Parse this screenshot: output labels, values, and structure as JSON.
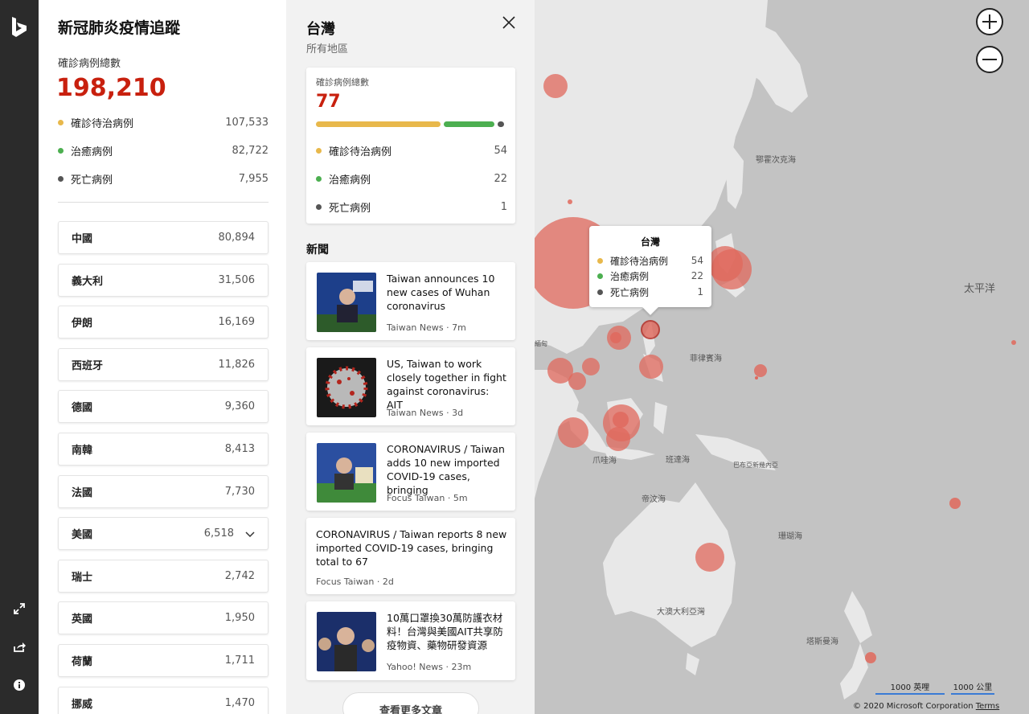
{
  "colors": {
    "active": "#e8b84b",
    "recovered": "#4caf50",
    "deaths": "#555555",
    "accent": "#c8200e",
    "bubble": "#e0685c"
  },
  "rail": {
    "logo_icon": "bing-logo-icon",
    "expand_icon": "expand-icon",
    "share_icon": "share-icon",
    "info_icon": "info-icon"
  },
  "stats": {
    "title": "新冠肺炎疫情追蹤",
    "total_label": "確診病例總數",
    "total_value": "198,210",
    "rows": [
      {
        "label": "確診待治病例",
        "value": "107,533"
      },
      {
        "label": "治癒病例",
        "value": "82,722"
      },
      {
        "label": "死亡病例",
        "value": "7,955"
      }
    ],
    "countries": [
      {
        "name": "中國",
        "value": "80,894"
      },
      {
        "name": "義大利",
        "value": "31,506"
      },
      {
        "name": "伊朗",
        "value": "16,169"
      },
      {
        "name": "西班牙",
        "value": "11,826"
      },
      {
        "name": "德國",
        "value": "9,360"
      },
      {
        "name": "南韓",
        "value": "8,413"
      },
      {
        "name": "法國",
        "value": "7,730"
      },
      {
        "name": "美國",
        "value": "6,518"
      },
      {
        "name": "瑞士",
        "value": "2,742"
      },
      {
        "name": "英國",
        "value": "1,950"
      },
      {
        "name": "荷蘭",
        "value": "1,711"
      },
      {
        "name": "挪威",
        "value": "1,470"
      }
    ]
  },
  "detail": {
    "title": "台灣",
    "subtitle": "所有地區",
    "summary": {
      "label": "確診病例總數",
      "value": "77",
      "bar": {
        "active": 54,
        "recovered": 22,
        "deaths": 1
      },
      "rows": [
        {
          "label": "確診待治病例",
          "value": "54"
        },
        {
          "label": "治癒病例",
          "value": "22"
        },
        {
          "label": "死亡病例",
          "value": "1"
        }
      ]
    },
    "news_heading": "新聞",
    "news": [
      {
        "headline": "Taiwan announces 10 new cases of Wuhan coronavirus",
        "source": "Taiwan News",
        "age": "· 7m"
      },
      {
        "headline": "US, Taiwan to work closely together in fight against coronavirus: AIT",
        "source": "Taiwan News",
        "age": "· 3d"
      },
      {
        "headline": "CORONAVIRUS / Taiwan adds 10 new imported COVID-19 cases, bringing",
        "source": "Focus Taiwan",
        "age": "· 5m"
      },
      {
        "headline": "CORONAVIRUS / Taiwan reports 8 new imported COVID-19 cases, bringing total to 67",
        "source": "Focus Taiwan",
        "age": "· 2d"
      },
      {
        "headline": "10萬口罩換30萬防護衣材料！台灣與美國AIT共享防疫物資、藥物研發資源",
        "source": "Yahoo! News",
        "age": "· 23m"
      }
    ],
    "more_label": "查看更多文章"
  },
  "map": {
    "labels": {
      "okhotsk": "鄂霍次克海",
      "pacific": "太平洋",
      "philippine_sea": "菲律賓海",
      "burma": "緬甸",
      "java_sea": "爪哇海",
      "banda_sea": "班達海",
      "bismarck": "巴布亞新幾內亞",
      "timor_sea": "帝汶海",
      "coral_sea": "珊瑚海",
      "great_bight": "大澳大利亞灣",
      "tasman_sea": "塔斯曼海"
    },
    "tooltip": {
      "title": "台灣",
      "rows": [
        {
          "label": "確診待治病例",
          "value": "54"
        },
        {
          "label": "治癒病例",
          "value": "22"
        },
        {
          "label": "死亡病例",
          "value": "1"
        }
      ]
    },
    "scale_miles": "1000 英哩",
    "scale_km": "1000 公里",
    "copyright": "© 2020 Microsoft Corporation",
    "terms": "Terms"
  }
}
